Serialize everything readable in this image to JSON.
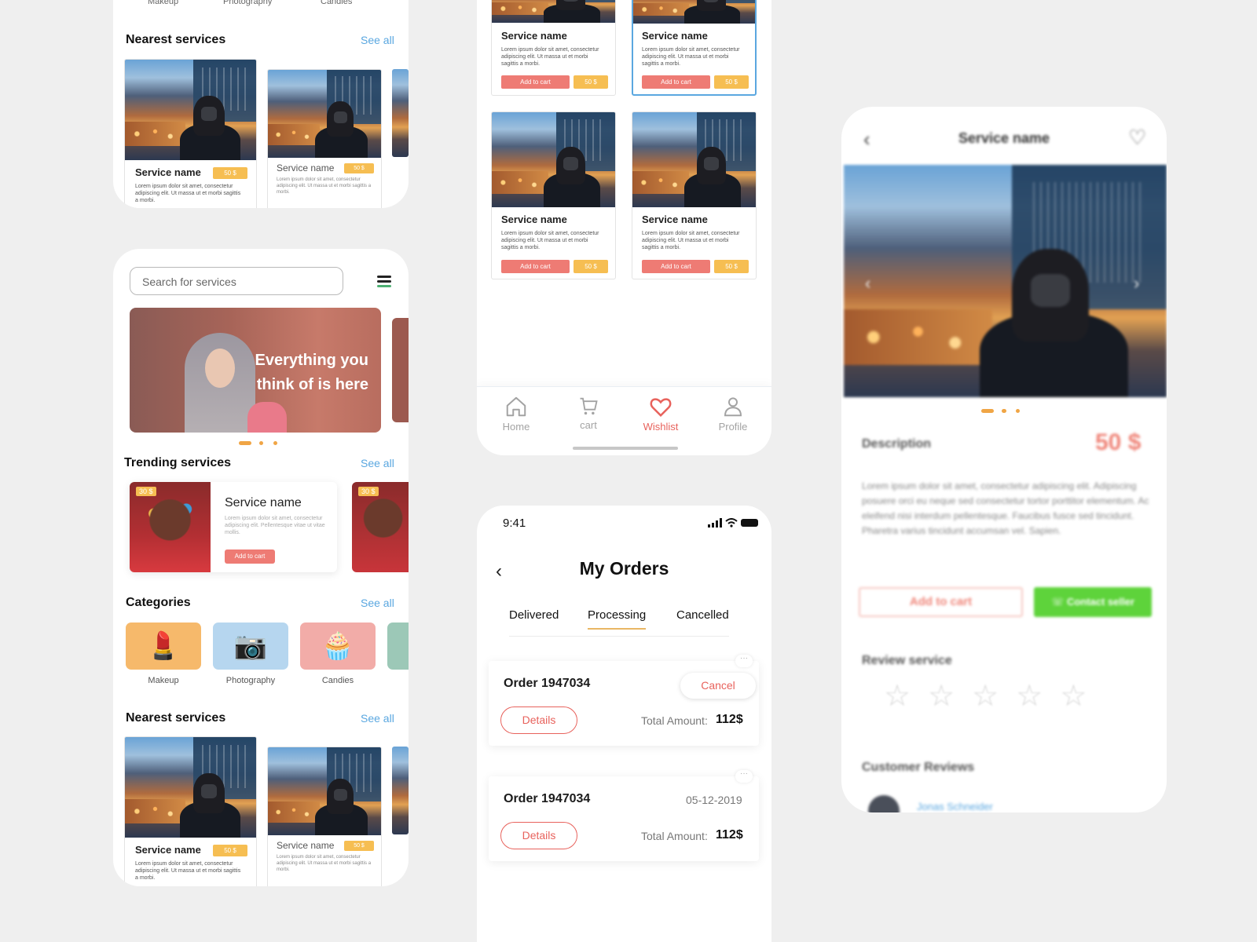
{
  "home_top": {
    "category_labels": [
      "Makeup",
      "Photography",
      "Candies"
    ],
    "nearest_title": "Nearest services",
    "see_all": "See all",
    "cards": [
      {
        "name": "Service name",
        "price": "50 $",
        "desc": "Lorem ipsum dolor sit amet, consectetur adipiscing elit. Ut massa ut et morbi sagittis a morbi."
      },
      {
        "name": "Service name",
        "price": "50 $",
        "desc": "Lorem ipsum dolor sit amet, consectetur adipiscing elit. Ut massa ut et morbi sagittis a morbi."
      }
    ]
  },
  "home": {
    "search_placeholder": "Search for services",
    "menu_icon": "hamburger-menu-icon",
    "banner_text_1": "Everything you",
    "banner_text_2": "think of is here",
    "trending_title": "Trending services",
    "see_all": "See all",
    "trending_card": {
      "badge": "30 $",
      "name": "Service name",
      "desc": "Lorem ipsum dolor sit amet, consectetur adipiscing elit. Pellentesque vitae ut vitae mollis.",
      "cta": "Add to cart"
    },
    "trending_badge_2": "30 $",
    "categories_title": "Categories",
    "categories": [
      {
        "label": "Makeup",
        "icon": "makeup-icon",
        "color": "#f6b96b"
      },
      {
        "label": "Photography",
        "icon": "camera-icon",
        "color": "#b6d6ef"
      },
      {
        "label": "Candies",
        "icon": "cupcake-icon",
        "color": "#f2aca8"
      },
      {
        "label": "",
        "icon": "",
        "color": "#9cc8b7"
      }
    ],
    "nearest_title": "Nearest services",
    "cards": [
      {
        "name": "Service name",
        "price": "50 $",
        "desc": "Lorem ipsum dolor sit amet, consectetur adipiscing elit. Ut massa ut et morbi sagittis a morbi."
      },
      {
        "name": "Service name",
        "price": "50 $",
        "desc": "Lorem ipsum dolor sit amet, consectetur adipiscing elit. Ut massa ut et morbi sagittis a morbi."
      }
    ]
  },
  "wishlist": {
    "items": [
      {
        "name": "Service name",
        "desc": "Lorem ipsum dolor sit amet, consectetur adipiscing elit. Ut massa ut et morbi sagittis a morbi.",
        "cta": "Add to cart",
        "price": "50 $"
      },
      {
        "name": "Service name",
        "desc": "Lorem ipsum dolor sit amet, consectetur adipiscing elit. Ut massa ut et morbi sagittis a morbi.",
        "cta": "Add to cart",
        "price": "50 $"
      },
      {
        "name": "Service name",
        "desc": "Lorem ipsum dolor sit amet, consectetur adipiscing elit. Ut massa ut et morbi sagittis a morbi.",
        "cta": "Add to cart",
        "price": "50 $"
      },
      {
        "name": "Service name",
        "desc": "Lorem ipsum dolor sit amet, consectetur adipiscing elit. Ut massa ut et morbi sagittis a morbi.",
        "cta": "Add to cart",
        "price": "50 $"
      }
    ],
    "tabs": [
      {
        "label": "Home",
        "icon": "home-icon"
      },
      {
        "label": "cart",
        "icon": "cart-icon"
      },
      {
        "label": "Wishlist",
        "icon": "heart-icon"
      },
      {
        "label": "Profile",
        "icon": "user-icon"
      }
    ],
    "active_color": "#e8625c"
  },
  "orders": {
    "time": "9:41",
    "title": "My Orders",
    "tabs": [
      "Delivered",
      "Processing",
      "Cancelled"
    ],
    "active_tab": "Processing",
    "accent": "#e8625c",
    "list": [
      {
        "order": "Order 1947034",
        "action": "Cancel",
        "details": "Details",
        "total_label": "Total Amount:",
        "total": "112$"
      },
      {
        "order": "Order 1947034",
        "date": "05-12-2019",
        "details": "Details",
        "total_label": "Total Amount:",
        "total": "112$"
      }
    ]
  },
  "detail": {
    "title": "Service name",
    "description_label": "Description",
    "price": "50 $",
    "body": "Lorem ipsum dolor sit amet, consectetur adipiscing elit. Adipiscing posuere orci eu neque sed consectetur tortor porttitor elementum. Ac eleifend nisi interdum pellentesque. Faucibus fusce sed tincidunt. Pharetra varius tincidunt accumsan vel. Sapien.",
    "add_to_cart": "Add to cart",
    "contact": "Contact seller",
    "review_label": "Review service",
    "customer_reviews": "Customer Reviews",
    "reviewer": "Jonas Schneider",
    "green": "#5ed33b"
  }
}
